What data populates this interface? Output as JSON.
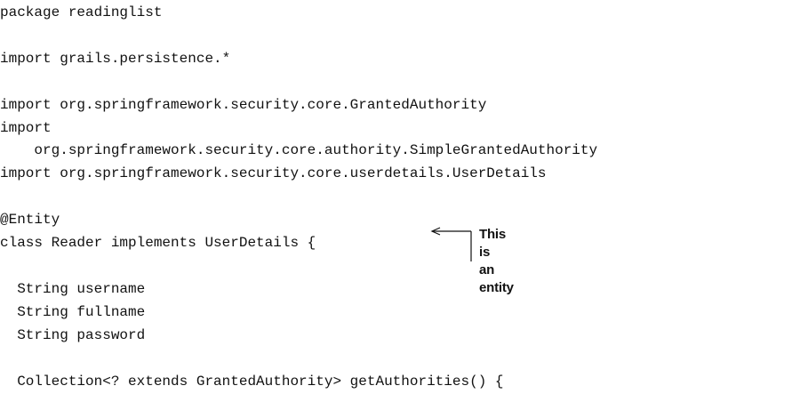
{
  "code_lines": [
    "package readinglist",
    "",
    "import grails.persistence.*",
    "",
    "import org.springframework.security.core.GrantedAuthority",
    "import",
    "    org.springframework.security.core.authority.SimpleGrantedAuthority",
    "import org.springframework.security.core.userdetails.UserDetails",
    "",
    "@Entity",
    "class Reader implements UserDetails {",
    "",
    "  String username",
    "  String fullname",
    "  String password",
    "",
    "  Collection<? extends GrantedAuthority> getAuthorities() {"
  ],
  "annotation": {
    "line1": "This is",
    "line2": "an entity"
  }
}
